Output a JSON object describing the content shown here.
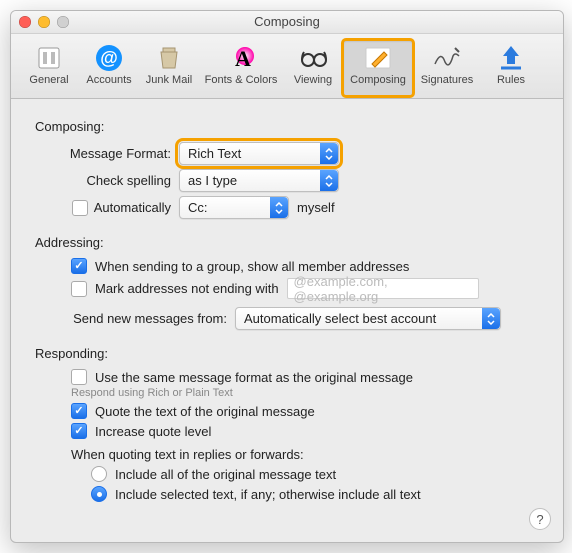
{
  "window": {
    "title": "Composing"
  },
  "toolbar": {
    "items": [
      {
        "label": "General"
      },
      {
        "label": "Accounts"
      },
      {
        "label": "Junk Mail"
      },
      {
        "label": "Fonts & Colors"
      },
      {
        "label": "Viewing"
      },
      {
        "label": "Composing"
      },
      {
        "label": "Signatures"
      },
      {
        "label": "Rules"
      }
    ]
  },
  "composing": {
    "title": "Composing:",
    "message_format_label": "Message Format:",
    "message_format_value": "Rich Text",
    "check_spelling_label": "Check spelling",
    "check_spelling_value": "as I type",
    "auto_label": "Automatically",
    "auto_value": "Cc:",
    "auto_suffix": "myself"
  },
  "addressing": {
    "title": "Addressing:",
    "group_label": "When sending to a group, show all member addresses",
    "mark_label": "Mark addresses not ending with",
    "mark_placeholder": "@example.com, @example.org",
    "send_from_label": "Send new messages from:",
    "send_from_value": "Automatically select best account"
  },
  "responding": {
    "title": "Responding:",
    "same_format": "Use the same message format as the original message",
    "same_format_sub": "Respond using Rich or Plain Text",
    "quote_text": "Quote the text of the original message",
    "increase": "Increase quote level",
    "quoting_header": "When quoting text in replies or forwards:",
    "include_all": "Include all of the original message text",
    "include_selected": "Include selected text, if any; otherwise include all text"
  },
  "help": "?"
}
